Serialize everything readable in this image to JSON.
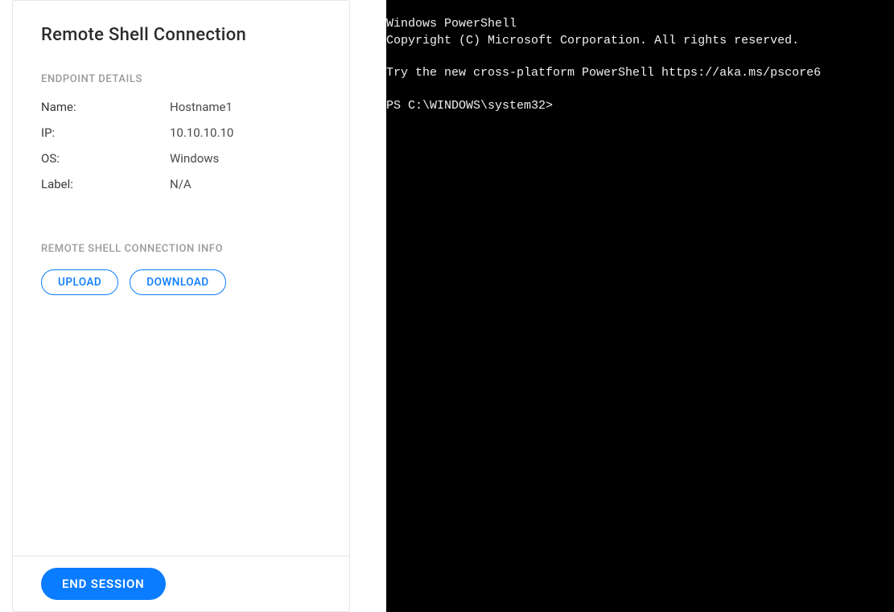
{
  "panel": {
    "title": "Remote Shell Connection",
    "endpoint_header": "ENDPOINT DETAILS",
    "details": {
      "name_label": "Name:",
      "name_value": "Hostname1",
      "ip_label": "IP:",
      "ip_value": "10.10.10.10",
      "os_label": "OS:",
      "os_value": "Windows",
      "label_label": "Label:",
      "label_value": "N/A"
    },
    "conn_header": "REMOTE SHELL CONNECTION INFO",
    "buttons": {
      "upload": "UPLOAD",
      "download": "DOWNLOAD",
      "end_session": "END SESSION"
    }
  },
  "terminal": {
    "line1": "Windows PowerShell",
    "line2": "Copyright (C) Microsoft Corporation. All rights reserved.",
    "line3": "",
    "line4": "Try the new cross-platform PowerShell https://aka.ms/pscore6",
    "line5": "",
    "line6": "PS C:\\WINDOWS\\system32>"
  }
}
